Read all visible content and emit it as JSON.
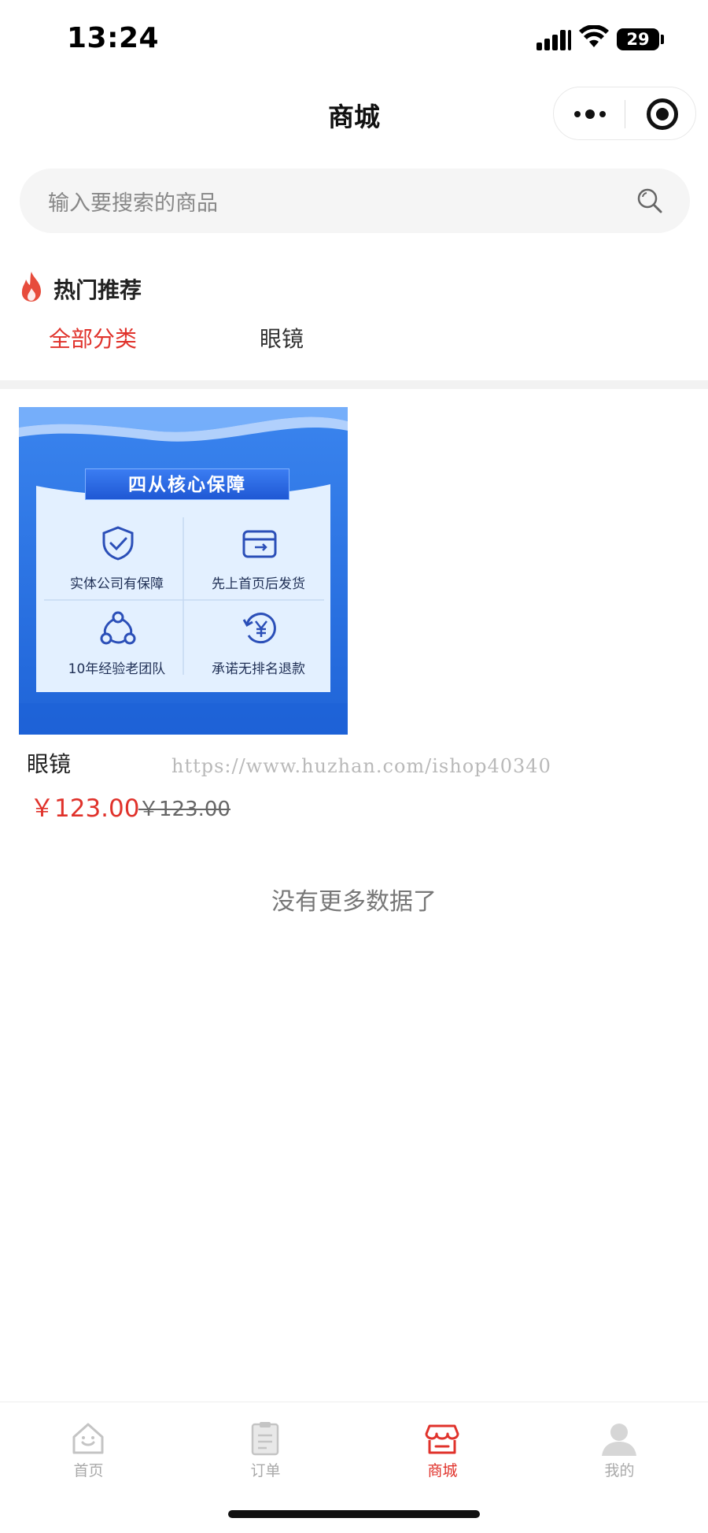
{
  "status_bar": {
    "time": "13:24",
    "battery": "29"
  },
  "nav": {
    "title": "商城"
  },
  "search": {
    "placeholder": "输入要搜索的商品"
  },
  "section": {
    "title": "热门推荐"
  },
  "categories": [
    {
      "label": "全部分类",
      "active": true
    },
    {
      "label": "眼镜",
      "active": false
    }
  ],
  "product": {
    "name": "眼镜",
    "price": "￥123.00",
    "original_price": "￥123.00",
    "image": {
      "banner_title": "四从核心保障",
      "features": [
        {
          "label": "实体公司有保障",
          "icon": "shield-check-icon"
        },
        {
          "label": "先上首页后发货",
          "icon": "delivery-box-icon"
        },
        {
          "label": "10年经验老团队",
          "icon": "team-network-icon"
        },
        {
          "label": "承诺无排名退款",
          "icon": "refund-yen-icon"
        }
      ]
    }
  },
  "watermark": "https://www.huzhan.com/ishop40340",
  "list_end": "没有更多数据了",
  "tabbar": [
    {
      "label": "首页",
      "icon": "home-icon",
      "active": false
    },
    {
      "label": "订单",
      "icon": "order-icon",
      "active": false
    },
    {
      "label": "商城",
      "icon": "store-icon",
      "active": true
    },
    {
      "label": "我的",
      "icon": "profile-icon",
      "active": false
    }
  ],
  "colors": {
    "accent": "#e0322b",
    "inactive": "#a9a9a9",
    "banner_blue": "#2a6fe0"
  }
}
